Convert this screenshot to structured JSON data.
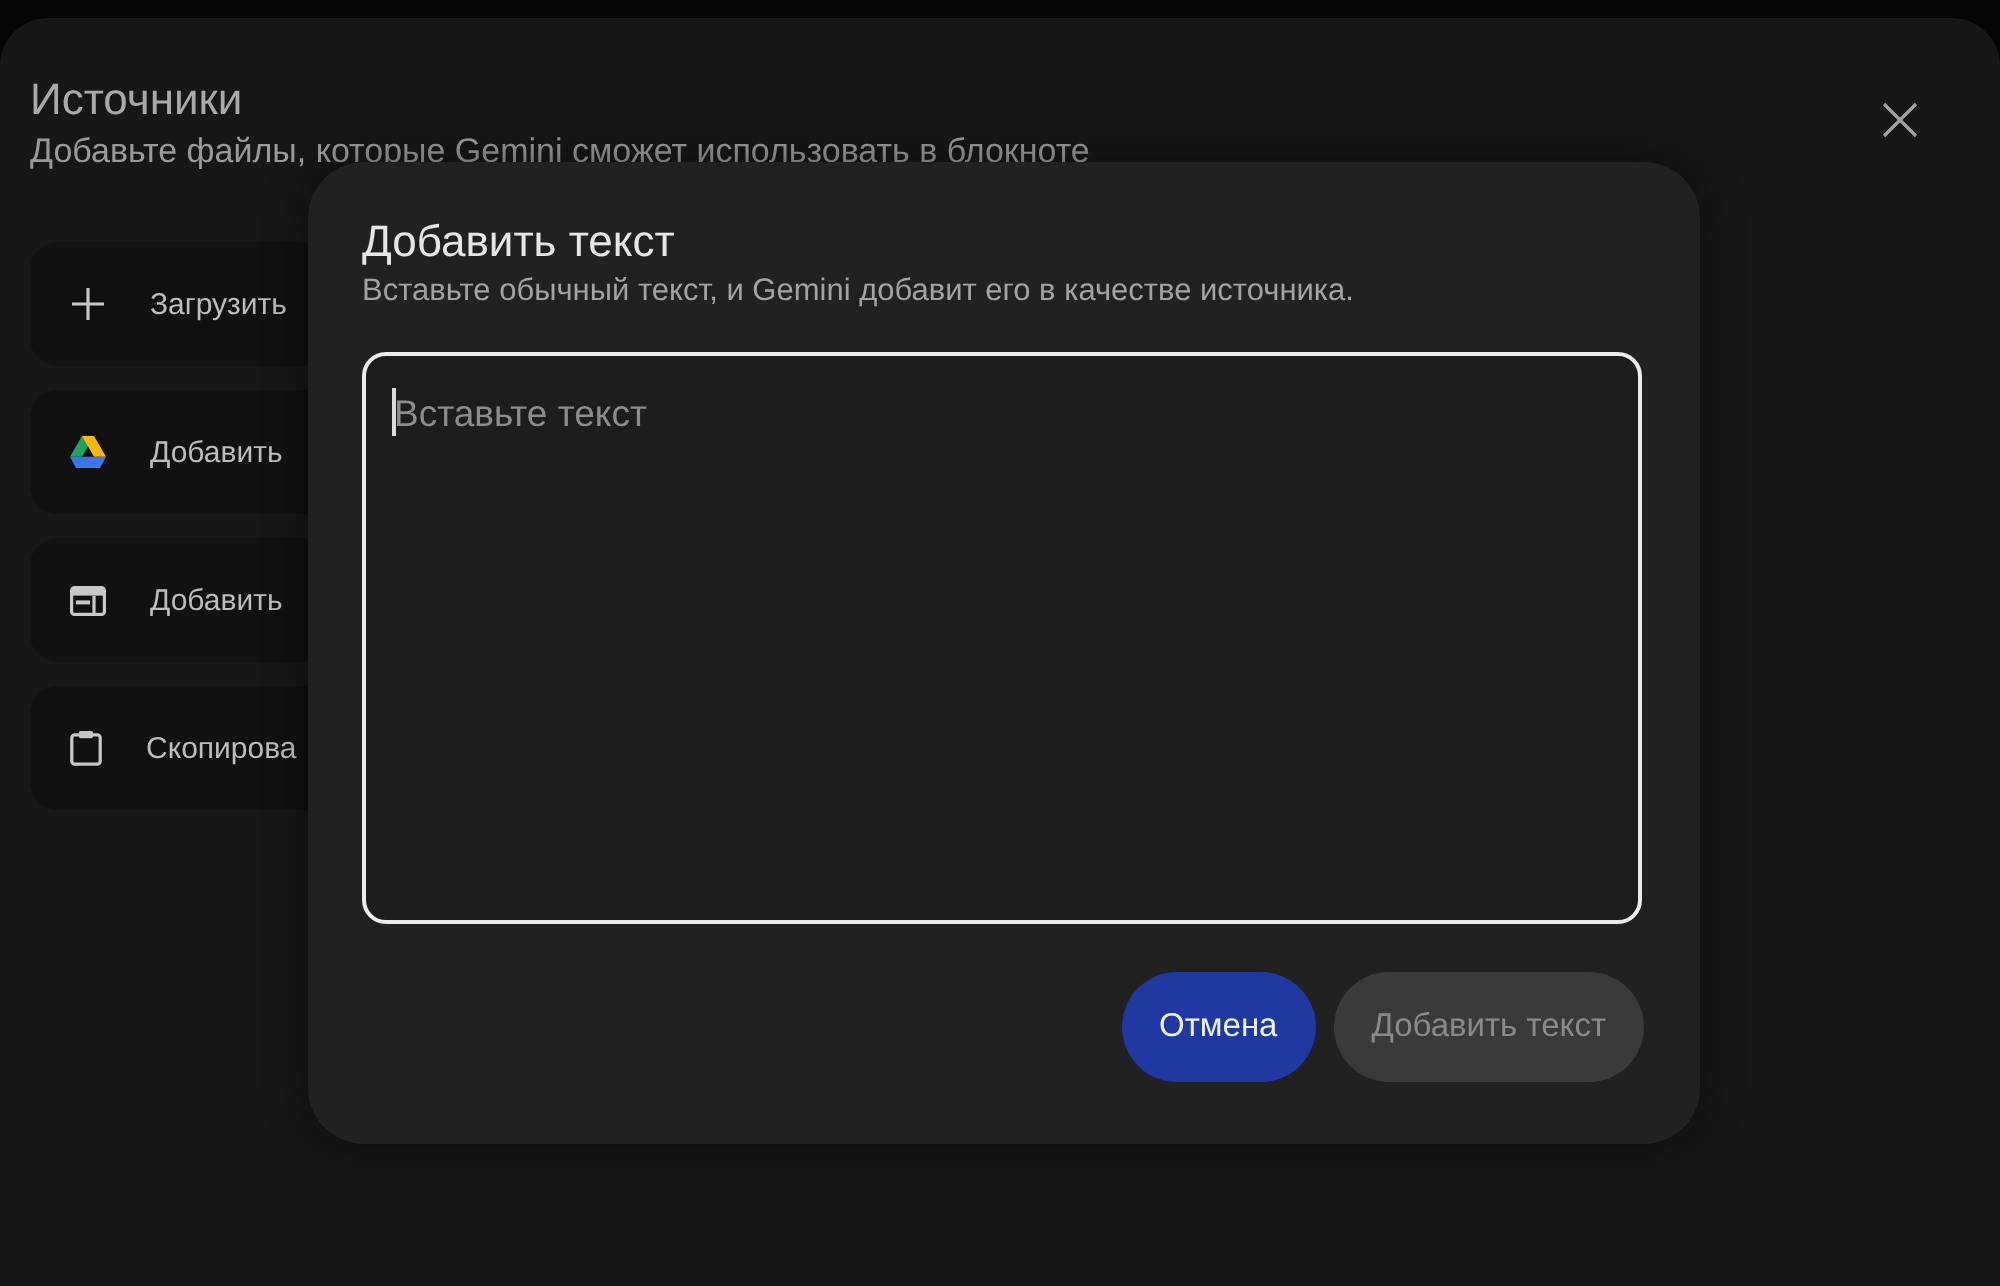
{
  "sources_panel": {
    "title": "Источники",
    "subtitle": "Добавьте файлы, которые Gemini сможет использовать в блокноте",
    "options": [
      {
        "kind": "upload",
        "label": "Загрузить"
      },
      {
        "kind": "drive",
        "label": "Добавить"
      },
      {
        "kind": "web",
        "label": "Добавить"
      },
      {
        "kind": "paste",
        "label": "Скопирова"
      }
    ]
  },
  "dialog": {
    "title": "Добавить текст",
    "subtitle": "Вставьте обычный текст, и Gemini добавит его в качестве источника.",
    "text_area": {
      "placeholder": "Вставьте текст",
      "focused": true
    },
    "buttons": [
      {
        "kind": "primary",
        "label": "Отмена",
        "disabled": false
      },
      {
        "kind": "secondary",
        "label": "Добавить текст",
        "disabled": true
      }
    ]
  }
}
